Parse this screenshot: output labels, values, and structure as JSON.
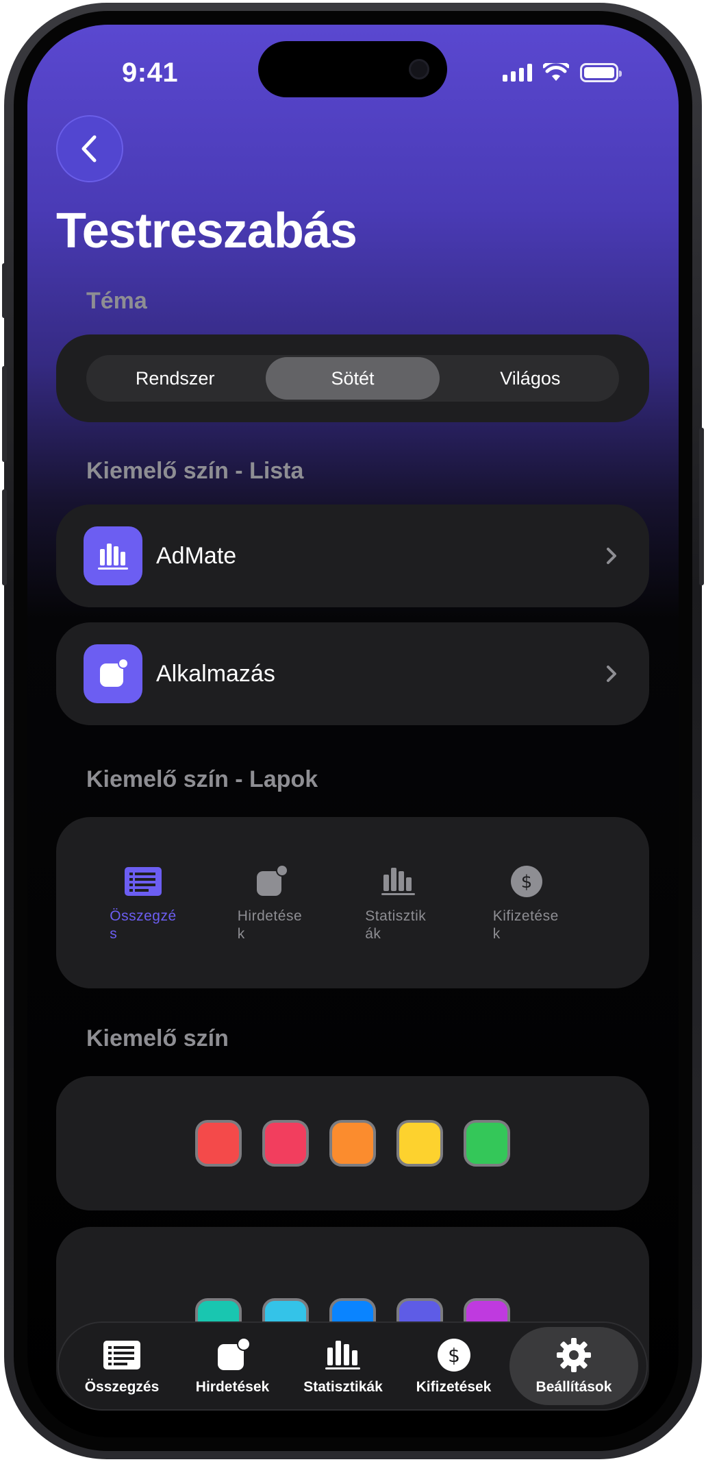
{
  "status_bar": {
    "time": "9:41"
  },
  "header": {
    "title": "Testreszabás"
  },
  "theme": {
    "label": "Téma",
    "options": [
      "Rendszer",
      "Sötét",
      "Világos"
    ],
    "selected": "Sötét"
  },
  "accent_list": {
    "label": "Kiemelő szín - Lista",
    "items": [
      {
        "label": "AdMate",
        "icon": "chart-bars-icon"
      },
      {
        "label": "Alkalmazás",
        "icon": "app-badge-icon"
      }
    ]
  },
  "accent_tabs": {
    "label": "Kiemelő szín - Lapok",
    "items": [
      {
        "line1": "Összegzé",
        "line2": "s",
        "icon": "list-icon",
        "active": true
      },
      {
        "line1": "Hirdetése",
        "line2": "k",
        "icon": "app-badge-icon",
        "active": false
      },
      {
        "line1": "Statisztik",
        "line2": "ák",
        "icon": "chart-bars-icon",
        "active": false
      },
      {
        "line1": "Kifizetése",
        "line2": "k",
        "icon": "dollar-icon",
        "active": false
      }
    ]
  },
  "accent_color": {
    "label": "Kiemelő szín",
    "row1": [
      "#f44a4a",
      "#f23e5e",
      "#fb8c2e",
      "#fdd22e",
      "#34c759"
    ],
    "row2": [
      "#19c6b0",
      "#34c3e8",
      "#0a84ff",
      "#5e5ce6",
      "#bf3adf"
    ]
  },
  "colors": {
    "accent": "#6c5ef2",
    "card": "#1e1e20",
    "muted": "#8e8e93"
  },
  "tabbar": {
    "items": [
      {
        "label": "Összegzés",
        "icon": "list-icon"
      },
      {
        "label": "Hirdetések",
        "icon": "app-badge-icon"
      },
      {
        "label": "Statisztikák",
        "icon": "chart-bars-icon"
      },
      {
        "label": "Kifizetések",
        "icon": "dollar-icon"
      },
      {
        "label": "Beállítások",
        "icon": "gear-icon",
        "active": true
      }
    ]
  }
}
